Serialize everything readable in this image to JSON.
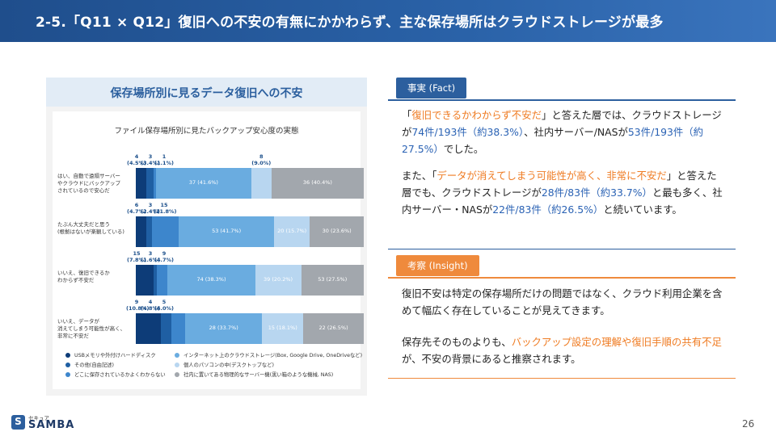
{
  "header": {
    "title": "2-5.「Q11 × Q12」復旧への不安の有無にかかわらず、主な保存場所はクラウドストレージが最多"
  },
  "figure": {
    "banner": "保存場所別に見るデータ復旧への不安",
    "chart_data": {
      "type": "bar",
      "stacked": true,
      "orientation": "horizontal",
      "title": "ファイル保存場所別に見たバックアップ安心度の実態",
      "categories": [
        "はい、自動で遠隔サーバー\nやクラウドにバックアップ\nされているので安心だ",
        "たぶん大丈夫だと思う\n(根拠はないが楽観している)",
        "いいえ、復旧できるか\nわからず不安だ",
        "いいえ、データが\n消えてしまう可能性が高く、\n非常に不安だ"
      ],
      "series": [
        {
          "name": "USBメモリや外付けハードディスク",
          "color": "#0d3c78",
          "values": [
            4,
            6,
            15,
            9
          ],
          "percents": [
            "4.5%",
            "4.7%",
            "7.8%",
            "10.8%"
          ]
        },
        {
          "name": "その他(自由記述)",
          "color": "#1f5fa3",
          "values": [
            3,
            3,
            3,
            4
          ],
          "percents": [
            "3.4%",
            "2.4%",
            "1.6%",
            "4.8%"
          ]
        },
        {
          "name": "どこに保存されているかよくわからない",
          "color": "#3d86cc",
          "values": [
            1,
            15,
            9,
            5
          ],
          "percents": [
            "1.1%",
            "11.8%",
            "4.7%",
            "6.0%"
          ]
        },
        {
          "name": "インターネット上のクラウドストレージ(Box, Google Drive, OneDriveなど)",
          "color": "#6aace0",
          "values": [
            37,
            53,
            74,
            28
          ],
          "percents": [
            "41.6%",
            "41.7%",
            "38.3%",
            "33.7%"
          ]
        },
        {
          "name": "個人のパソコンの中(デスクトップなど)",
          "color": "#b8d6f0",
          "values": [
            8,
            20,
            39,
            15
          ],
          "percents": [
            "9.0%",
            "15.7%",
            "20.2%",
            "18.1%"
          ]
        },
        {
          "name": "社内に置いてある物理的なサーバー機(黒い箱のような機械, NAS)",
          "color": "#a2a7ad",
          "values": [
            36,
            30,
            53,
            22
          ],
          "percents": [
            "40.4%",
            "23.6%",
            "27.5%",
            "26.5%"
          ]
        }
      ],
      "bar_labels": [
        [
          "",
          "",
          "",
          "37 (41.6%)",
          "",
          "36 (40.4%)"
        ],
        [
          "",
          "",
          "",
          "53 (41.7%)",
          "20 (15.7%)",
          "30 (23.6%)"
        ],
        [
          "",
          "",
          "",
          "74 (38.3%)",
          "39 (20.2%)",
          "53 (27.5%)"
        ],
        [
          "",
          "",
          "",
          "28 (33.7%)",
          "15 (18.1%)",
          "22 (26.5%)"
        ]
      ],
      "small_labels": [
        [
          {
            "n": "4",
            "p": "(4.5%)",
            "s": 0
          },
          {
            "n": "3",
            "p": "(3.4%)",
            "s": 1
          },
          {
            "n": "1",
            "p": "(1.1%)",
            "s": 2
          },
          {
            "n": "8",
            "p": "(9.0%)",
            "s": 4
          }
        ],
        [
          {
            "n": "6",
            "p": "(4.7%)",
            "s": 0
          },
          {
            "n": "3",
            "p": "(2.4%)",
            "s": 1
          },
          {
            "n": "15",
            "p": "(11.8%)",
            "s": 2
          }
        ],
        [
          {
            "n": "15",
            "p": "(7.8%)",
            "s": 0
          },
          {
            "n": "3",
            "p": "(1.6%)",
            "s": 1
          },
          {
            "n": "9",
            "p": "(4.7%)",
            "s": 2
          }
        ],
        [
          {
            "n": "9",
            "p": "(10.8%)",
            "s": 0
          },
          {
            "n": "4",
            "p": "(4.8%)",
            "s": 1
          },
          {
            "n": "5",
            "p": "(6.0%)",
            "s": 2
          }
        ]
      ],
      "legend": [
        "USBメモリや外付けハードディスク",
        "その他(自由記述)",
        "どこに保存されているかよくわからない",
        "インターネット上のクラウドストレージ(Box, Google Drive, OneDriveなど)",
        "個人のパソコンの中(デスクトップなど)",
        "社内に置いてある物理的なサーバー機(黒い箱のような機械, NAS)"
      ]
    }
  },
  "fact": {
    "tag": "事実 (Fact)",
    "p1": [
      {
        "t": "「",
        "c": ""
      },
      {
        "t": "復旧できるかわからず不安だ",
        "c": "hl-o"
      },
      {
        "t": "」と答えた層では、クラウドストレージが",
        "c": ""
      },
      {
        "t": "74件/193件（約38.3%）",
        "c": "hl-b"
      },
      {
        "t": "、社内サーバー/NASが",
        "c": ""
      },
      {
        "t": "53件/193件（約27.5%）",
        "c": "hl-b"
      },
      {
        "t": "でした。",
        "c": ""
      }
    ],
    "p2": [
      {
        "t": "また、「",
        "c": ""
      },
      {
        "t": "データが消えてしまう可能性が高く、非常に不安だ",
        "c": "hl-o"
      },
      {
        "t": "」と答えた層でも、クラウドストレージが",
        "c": ""
      },
      {
        "t": "28件/83件（約33.7%）",
        "c": "hl-b"
      },
      {
        "t": "と最も多く、社内サーバー・NASが",
        "c": ""
      },
      {
        "t": "22件/83件（約26.5%）",
        "c": "hl-b"
      },
      {
        "t": "と続いています。",
        "c": ""
      }
    ]
  },
  "insight": {
    "tag": "考察 (Insight)",
    "p1": [
      {
        "t": "復旧不安は特定の保存場所だけの問題ではなく、クラウド利用企業を含めて幅広く存在していることが見えてきます。",
        "c": ""
      }
    ],
    "p2": [
      {
        "t": "保存先そのものよりも、",
        "c": ""
      },
      {
        "t": "バックアップ設定の理解や復旧手順の共有不足",
        "c": "hl-o"
      },
      {
        "t": "が、不安の背景にあると推察されます。",
        "c": ""
      }
    ]
  },
  "footer": {
    "logo_small": "セキュア",
    "logo_main": "SAMBA",
    "logo_mark": "S",
    "page": "26"
  }
}
